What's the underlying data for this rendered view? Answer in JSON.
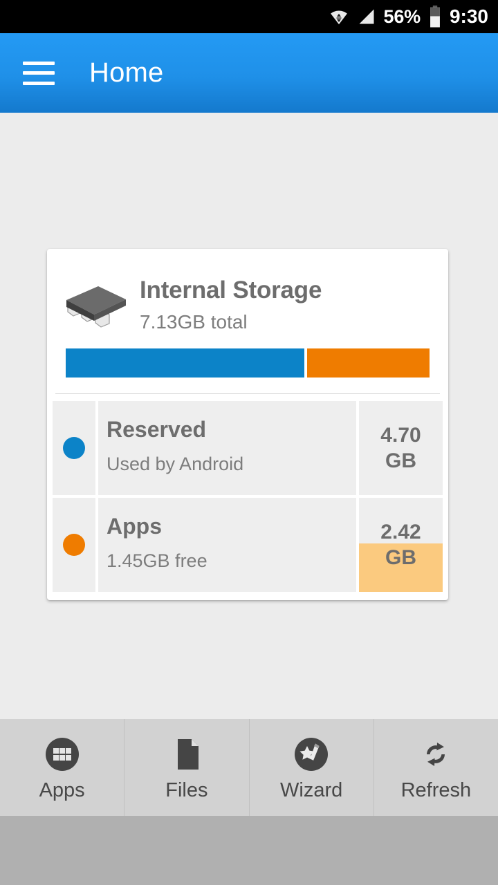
{
  "statusbar": {
    "wifi_icon": "wifi-icon",
    "signal_icon": "cellular-signal-icon",
    "battery_percent": "56%",
    "battery_icon": "battery-icon",
    "clock": "9:30"
  },
  "appbar": {
    "menu_icon": "hamburger-menu-icon",
    "title": "Home",
    "background_color": "#1f90e8"
  },
  "card": {
    "icon": "memory-chip-icon",
    "title": "Internal Storage",
    "subtitle": "7.13GB total",
    "usage_bar": {
      "segments": [
        {
          "name": "Reserved",
          "color": "#0c83c8",
          "percent": 66
        },
        {
          "name": "Apps",
          "color": "#ef7c00",
          "percent": 34
        }
      ]
    },
    "rows": [
      {
        "dot_color": "#0c83c8",
        "title": "Reserved",
        "subtitle": "Used by Android",
        "value": "4.70\nGB",
        "value_number": "4.70",
        "value_unit": "GB",
        "fill_percent": 0,
        "fill_color": "#fbca7f"
      },
      {
        "dot_color": "#ef7c00",
        "title": "Apps",
        "subtitle": "1.45GB free",
        "value": "2.42\nGB",
        "value_number": "2.42",
        "value_unit": "GB",
        "fill_percent": 52,
        "fill_color": "#fbca7f"
      }
    ]
  },
  "bottom_nav": {
    "items": [
      {
        "icon": "apps-grid-icon",
        "label": "Apps"
      },
      {
        "icon": "file-document-icon",
        "label": "Files"
      },
      {
        "icon": "magic-wand-icon",
        "label": "Wizard"
      },
      {
        "icon": "refresh-icon",
        "label": "Refresh"
      }
    ]
  }
}
